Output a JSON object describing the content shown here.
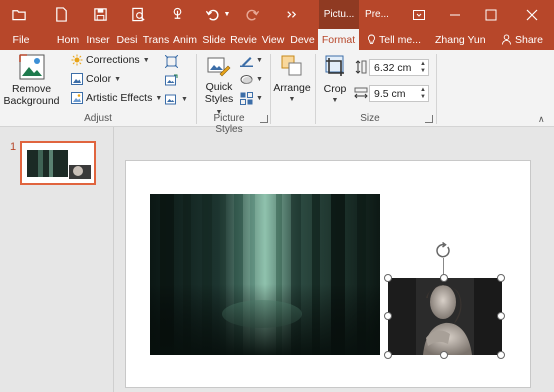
{
  "quick_access": {
    "icons": [
      "open-icon",
      "new-file-icon",
      "save-icon",
      "print-preview-icon",
      "touch-mode-icon",
      "undo-icon",
      "redo-icon",
      "customize-icon"
    ]
  },
  "contextual_tabs": {
    "picture": "Pictu...",
    "presentation": "Pre..."
  },
  "tabs": [
    {
      "label": "File"
    },
    {
      "label": "Hom"
    },
    {
      "label": "Inser"
    },
    {
      "label": "Desi"
    },
    {
      "label": "Trans"
    },
    {
      "label": "Anim"
    },
    {
      "label": "Slide"
    },
    {
      "label": "Revie"
    },
    {
      "label": "View"
    },
    {
      "label": "Deve"
    },
    {
      "label": "Format"
    }
  ],
  "tell_me": "Tell me...",
  "user": "Zhang Yun",
  "share": "Share",
  "ribbon": {
    "adjust": {
      "remove_background_line1": "Remove",
      "remove_background_line2": "Background",
      "corrections": "Corrections",
      "color": "Color",
      "artistic_effects": "Artistic Effects",
      "label": "Adjust"
    },
    "picture_styles": {
      "quick_styles_line1": "Quick",
      "quick_styles_line2": "Styles",
      "label": "Picture Styles"
    },
    "arrange": {
      "label": "Arrange"
    },
    "size": {
      "crop": "Crop",
      "height": "6.32 cm",
      "width": "9.5 cm",
      "label": "Size"
    }
  },
  "thumbnails": [
    {
      "number": "1"
    }
  ],
  "colors": {
    "accent": "#b7472a",
    "thumb_selected": "#e0643e"
  }
}
